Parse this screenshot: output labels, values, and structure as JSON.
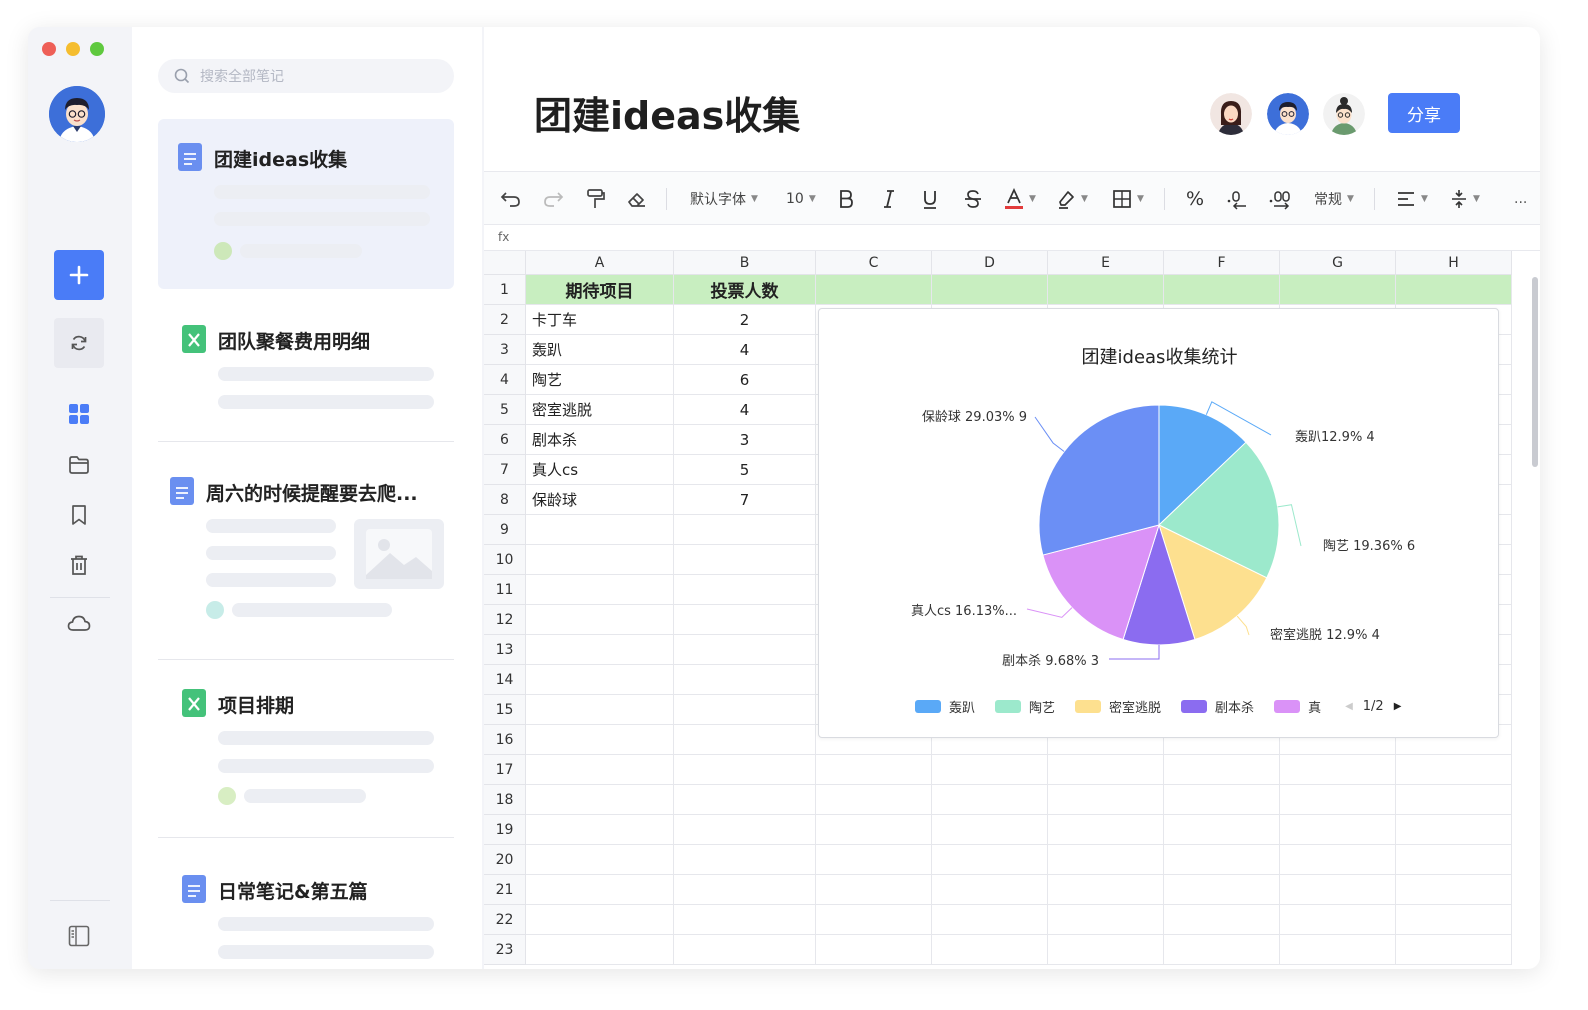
{
  "window": {
    "traffic_colors": [
      "#ee5f57",
      "#f5bd2f",
      "#5fc93f"
    ]
  },
  "rail": {
    "avatar": "user-avatar"
  },
  "notes": {
    "search_placeholder": "搜索全部笔记",
    "items": [
      {
        "title": "团建ideas收集",
        "type": "doc"
      },
      {
        "title": "团队聚餐费用明细",
        "type": "sheet"
      },
      {
        "title": "周六的时候提醒要去爬...",
        "type": "doc"
      },
      {
        "title": "项目排期",
        "type": "sheet"
      },
      {
        "title": "日常笔记&第五篇",
        "type": "doc"
      }
    ]
  },
  "editor": {
    "title": "团建ideas收集",
    "share_label": "分享"
  },
  "toolbar": {
    "font_name": "默认字体",
    "font_size": "10",
    "percent": "%",
    "number_format": "常规",
    "more": "..."
  },
  "fx_label": "fx",
  "sheet": {
    "columns": [
      "A",
      "B",
      "C",
      "D",
      "E",
      "F",
      "G",
      "H"
    ],
    "rows": [
      "1",
      "2",
      "3",
      "4",
      "5",
      "6",
      "7",
      "8",
      "9",
      "10",
      "11",
      "12",
      "13",
      "14",
      "15",
      "16",
      "17",
      "18",
      "19",
      "20",
      "21",
      "22",
      "23"
    ],
    "header": [
      "期待项目",
      "投票人数"
    ],
    "data": [
      [
        "卡丁车",
        "2"
      ],
      [
        "轰趴",
        "4"
      ],
      [
        "陶艺",
        "6"
      ],
      [
        "密室逃脱",
        "4"
      ],
      [
        "剧本杀",
        "3"
      ],
      [
        "真人cs",
        "5"
      ],
      [
        "保龄球",
        "7"
      ]
    ]
  },
  "chart_data": {
    "type": "pie",
    "title": "团建ideas收集统计",
    "slices": [
      {
        "name": "轰趴",
        "label": "轰趴12.9% 4",
        "value": 4,
        "percent": 12.9,
        "color": "#5aa9f7"
      },
      {
        "name": "陶艺",
        "label": "陶艺 19.36% 6",
        "value": 6,
        "percent": 19.36,
        "color": "#9ce9cc"
      },
      {
        "name": "密室逃脱",
        "label": "密室逃脱 12.9% 4",
        "value": 4,
        "percent": 12.9,
        "color": "#fde08f"
      },
      {
        "name": "剧本杀",
        "label": "剧本杀 9.68% 3",
        "value": 3,
        "percent": 9.68,
        "color": "#8b6cf0"
      },
      {
        "name": "真人cs",
        "label": "真人cs 16.13%...",
        "value": 5,
        "percent": 16.13,
        "color": "#da92f7"
      },
      {
        "name": "保龄球",
        "label": "保龄球 29.03% 9",
        "value": 9,
        "percent": 29.03,
        "color": "#6b8ff5"
      }
    ],
    "legend": [
      "轰趴",
      "陶艺",
      "密室逃脱",
      "剧本杀",
      "真"
    ],
    "legend_page": "1/2"
  }
}
